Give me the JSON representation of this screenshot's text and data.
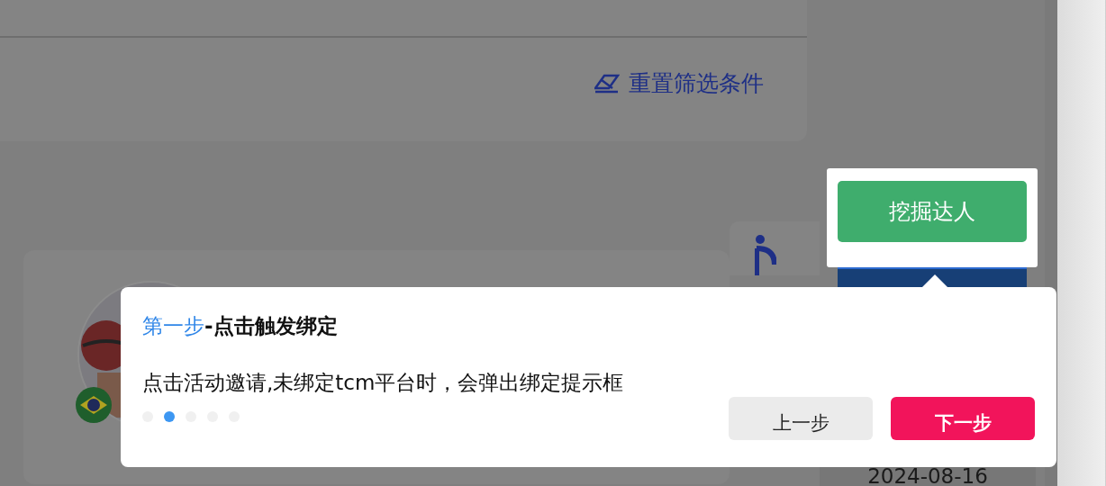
{
  "filter_panel": {
    "reset_button": "重置筛选条件"
  },
  "talent_card": {
    "date": "2024-08-16"
  },
  "highlighted_action": {
    "label": "挖掘达人"
  },
  "guide": {
    "title": {
      "step": "第一步",
      "text": "-点击触发绑定"
    },
    "description": "点击活动邀请,未绑定tcm平台时，会弹出绑定提示框",
    "steps": [
      {
        "selected": false
      },
      {
        "selected": true
      },
      {
        "selected": false
      },
      {
        "selected": false
      },
      {
        "selected": false
      }
    ],
    "buttons": [
      {
        "kind": "secondary",
        "label": "上一步"
      },
      {
        "kind": "primary",
        "label": "下一步"
      }
    ]
  }
}
